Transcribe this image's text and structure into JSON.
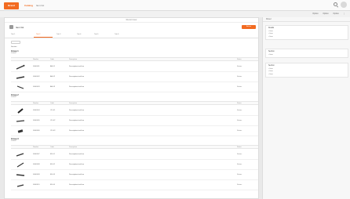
{
  "topbar": {
    "logo": "Brand",
    "crumb_primary": "Catalog",
    "crumb_secondary": "Item list"
  },
  "subbar": {
    "actions": [
      "Option",
      "Option",
      "Option"
    ]
  },
  "main": {
    "head": "Record view",
    "page_title": "Item list",
    "primary_button": "Action",
    "tabs": [
      "Tab 1",
      "Tab 2",
      "Tab 3",
      "Tab 4",
      "Tab 5",
      "Tab 6"
    ],
    "section_label": "Section",
    "columns": [
      "",
      "Number",
      "Code",
      "Description",
      "Status"
    ],
    "groups": [
      {
        "title": "Group 1",
        "sub": "Subtitle",
        "rows": [
          {
            "num": "0000001",
            "code": "AB-01",
            "desc": "Description text line",
            "status": "Status"
          },
          {
            "num": "0000002",
            "code": "AB-02",
            "desc": "Description text line",
            "status": "Status"
          },
          {
            "num": "0000003",
            "code": "AB-03",
            "desc": "Description text line",
            "status": "Status"
          }
        ]
      },
      {
        "title": "Group 2",
        "sub": "Subtitle",
        "rows": [
          {
            "num": "0000004",
            "code": "CD-01",
            "desc": "Description text line",
            "status": "Status"
          },
          {
            "num": "0000005",
            "code": "CD-02",
            "desc": "Description text line",
            "status": "Status"
          },
          {
            "num": "0000006",
            "code": "CD-03",
            "desc": "Description text line",
            "status": "Status"
          }
        ]
      },
      {
        "title": "Group 3",
        "sub": "Subtitle",
        "rows": [
          {
            "num": "0000007",
            "code": "EF-01",
            "desc": "Description text line",
            "status": "Status"
          },
          {
            "num": "0000008",
            "code": "EF-02",
            "desc": "Description text line",
            "status": "Status"
          },
          {
            "num": "0000009",
            "code": "EF-03",
            "desc": "Description text line",
            "status": "Status"
          },
          {
            "num": "0000010",
            "code": "EF-04",
            "desc": "Description text line",
            "status": "Status"
          }
        ]
      }
    ]
  },
  "side": {
    "head": "Panel",
    "boxes": [
      {
        "title": "Details",
        "items": [
          "Item",
          "Item",
          "Item"
        ]
      },
      {
        "title": "Section",
        "items": [
          "Item"
        ]
      },
      {
        "title": "Section",
        "items": [
          "Item",
          "Item",
          "Item"
        ]
      }
    ]
  },
  "colors": {
    "accent": "#f26b21"
  }
}
